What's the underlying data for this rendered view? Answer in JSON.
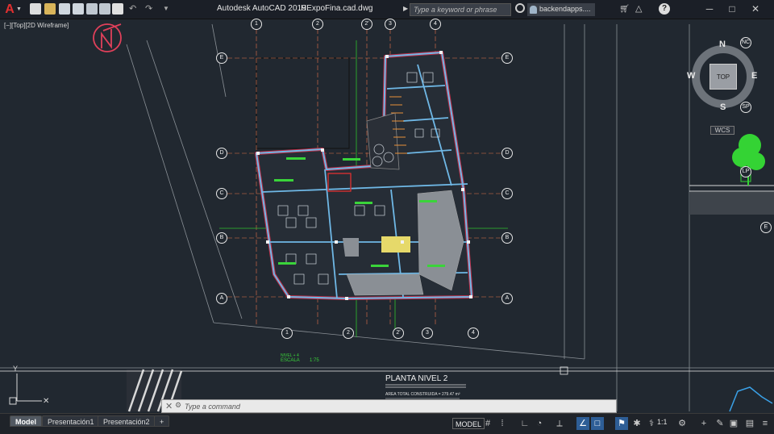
{
  "app": {
    "title": "Autodesk AutoCAD 2019",
    "file": "HExpoFina.cad.dwg",
    "logo_letter": "A"
  },
  "search": {
    "placeholder": "Type a keyword or phrase"
  },
  "user": {
    "name": "backendapps...."
  },
  "viewport": {
    "label": "[−][Top][2D Wireframe]"
  },
  "viewcube": {
    "north": "N",
    "south": "S",
    "east": "E",
    "west": "W",
    "top": "TOP",
    "wcs": "WCS"
  },
  "drawing": {
    "sheet_title": "PLANTA NIVEL 2",
    "area_text": "AREA TOTAL CONSTRUIDA = 279.47 m²",
    "scale_label": "ESCALA",
    "scale_value": "1:75",
    "level_label": "NIVEL + 4",
    "top_grid_labels": [
      "1",
      "2",
      "2'",
      "3",
      "4"
    ],
    "bottom_grid_labels": [
      "1",
      "2",
      "2'",
      "3",
      "4"
    ],
    "left_grid_labels": [
      "E",
      "D",
      "C",
      "B",
      "A"
    ],
    "right_grid_labels": [
      "E",
      "D",
      "C",
      "B",
      "A"
    ],
    "side_labels": [
      "NC",
      "SP",
      "LP",
      "E"
    ]
  },
  "command": {
    "placeholder": "Type a command"
  },
  "layout_tabs": [
    "Model",
    "Presentación1",
    "Presentación2",
    "+"
  ],
  "status": {
    "model": "MODEL",
    "scale": "1:1"
  },
  "colors": {
    "background": "#212830",
    "grid": "#e8744a",
    "walls": "#6fb8e6",
    "accent": "#2e5e96"
  }
}
